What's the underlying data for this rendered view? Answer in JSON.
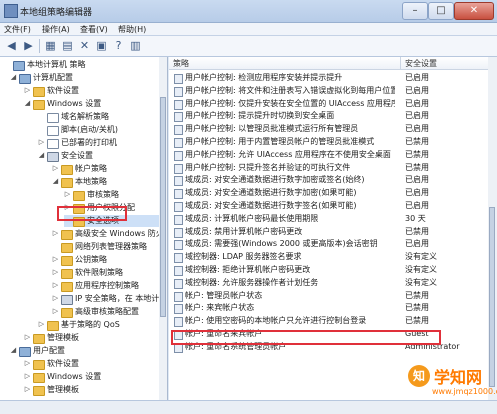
{
  "window": {
    "title": "本地组策略编辑器",
    "minimize_glyph": "–",
    "maximize_glyph": "□",
    "close_glyph": "✕"
  },
  "menu": [
    "文件(F)",
    "操作(A)",
    "查看(V)",
    "帮助(H)"
  ],
  "toolbar_glyphs": [
    "◀",
    "▶",
    "▦",
    "▤",
    "✕",
    "▣",
    "?",
    "▥"
  ],
  "tree": [
    {
      "label": "本地计算机 策略",
      "exp": "",
      "icon": "computer"
    },
    {
      "label": "计算机配置",
      "exp": "◢",
      "icon": "computer"
    },
    {
      "label": "软件设置",
      "exp": "▷",
      "icon": "folder"
    },
    {
      "label": "Windows 设置",
      "exp": "◢",
      "icon": "folder"
    },
    {
      "label": "域名解析策略",
      "exp": "",
      "icon": "doc"
    },
    {
      "label": "脚本(启动/关机)",
      "exp": "",
      "icon": "doc"
    },
    {
      "label": "已部署的打印机",
      "exp": "▷",
      "icon": "doc"
    },
    {
      "label": "安全设置",
      "exp": "◢",
      "icon": "shield"
    },
    {
      "label": "帐户策略",
      "exp": "▷",
      "icon": "folder"
    },
    {
      "label": "本地策略",
      "exp": "◢",
      "icon": "folder"
    },
    {
      "label": "审核策略",
      "exp": "▷",
      "icon": "folder"
    },
    {
      "label": "用户权限分配",
      "exp": "▷",
      "icon": "folder"
    },
    {
      "label": "安全选项",
      "exp": "",
      "icon": "folder"
    },
    {
      "label": "高级安全 Windows 防火",
      "exp": "▷",
      "icon": "folder"
    },
    {
      "label": "网络列表管理器策略",
      "exp": "",
      "icon": "folder"
    },
    {
      "label": "公钥策略",
      "exp": "▷",
      "icon": "folder"
    },
    {
      "label": "软件限制策略",
      "exp": "▷",
      "icon": "folder"
    },
    {
      "label": "应用程序控制策略",
      "exp": "▷",
      "icon": "folder"
    },
    {
      "label": "IP 安全策略，在 本地计",
      "exp": "▷",
      "icon": "shield"
    },
    {
      "label": "高级审核策略配置",
      "exp": "▷",
      "icon": "folder"
    },
    {
      "label": "基于策略的 QoS",
      "exp": "▷",
      "icon": "folder"
    },
    {
      "label": "管理模板",
      "exp": "▷",
      "icon": "folder"
    },
    {
      "label": "用户配置",
      "exp": "◢",
      "icon": "computer"
    },
    {
      "label": "软件设置",
      "exp": "▷",
      "icon": "folder"
    },
    {
      "label": "Windows 设置",
      "exp": "▷",
      "icon": "folder"
    },
    {
      "label": "管理模板",
      "exp": "▷",
      "icon": "folder"
    }
  ],
  "list": {
    "col_policy": "策略",
    "col_setting": "安全设置",
    "rows": [
      {
        "policy": "用户帐户控制: 检测应用程序安装并提示提升",
        "setting": "已启用"
      },
      {
        "policy": "用户帐户控制: 将文件和注册表写入错误虚拟化到每用户位置",
        "setting": "已启用"
      },
      {
        "policy": "用户帐户控制: 仅提升安装在安全位置的 UIAccess 应用程序",
        "setting": "已启用"
      },
      {
        "policy": "用户帐户控制: 提示提升时切换到安全桌面",
        "setting": "已启用"
      },
      {
        "policy": "用户帐户控制: 以管理员批准模式运行所有管理员",
        "setting": "已启用"
      },
      {
        "policy": "用户帐户控制: 用于内置管理员帐户的管理员批准模式",
        "setting": "已禁用"
      },
      {
        "policy": "用户帐户控制: 允许 UIAccess 应用程序在不使用安全桌面",
        "setting": "已禁用"
      },
      {
        "policy": "用户帐户控制: 只提升签名并验证的可执行文件",
        "setting": "已禁用"
      },
      {
        "policy": "域成员: 对安全通道数据进行数字加密或签名(始终)",
        "setting": "已启用"
      },
      {
        "policy": "域成员: 对安全通道数据进行数字加密(如果可能)",
        "setting": "已启用"
      },
      {
        "policy": "域成员: 对安全通道数据进行数字签名(如果可能)",
        "setting": "已启用"
      },
      {
        "policy": "域成员: 计算机帐户密码最长使用期限",
        "setting": "30 天"
      },
      {
        "policy": "域成员: 禁用计算机帐户密码更改",
        "setting": "已禁用"
      },
      {
        "policy": "域成员: 需要强(Windows 2000 或更高版本)会话密钥",
        "setting": "已启用"
      },
      {
        "policy": "域控制器: LDAP 服务器签名要求",
        "setting": "没有定义"
      },
      {
        "policy": "域控制器: 拒绝计算机帐户密码更改",
        "setting": "没有定义"
      },
      {
        "policy": "域控制器: 允许服务器操作者计划任务",
        "setting": "没有定义"
      },
      {
        "policy": "帐户: 管理员帐户状态",
        "setting": "已禁用"
      },
      {
        "policy": "帐户: 来宾帐户状态",
        "setting": "已禁用"
      },
      {
        "policy": "帐户: 使用空密码的本地帐户只允许进行控制台登录",
        "setting": "已禁用"
      },
      {
        "policy": "帐户: 重命名来宾帐户",
        "setting": "Guest"
      },
      {
        "policy": "帐户: 重命名系统管理员帐户",
        "setting": "Administrator"
      }
    ]
  },
  "watermark": {
    "logo_glyph": "知",
    "title": "学知网",
    "url": "www.jmqz1000.com"
  }
}
